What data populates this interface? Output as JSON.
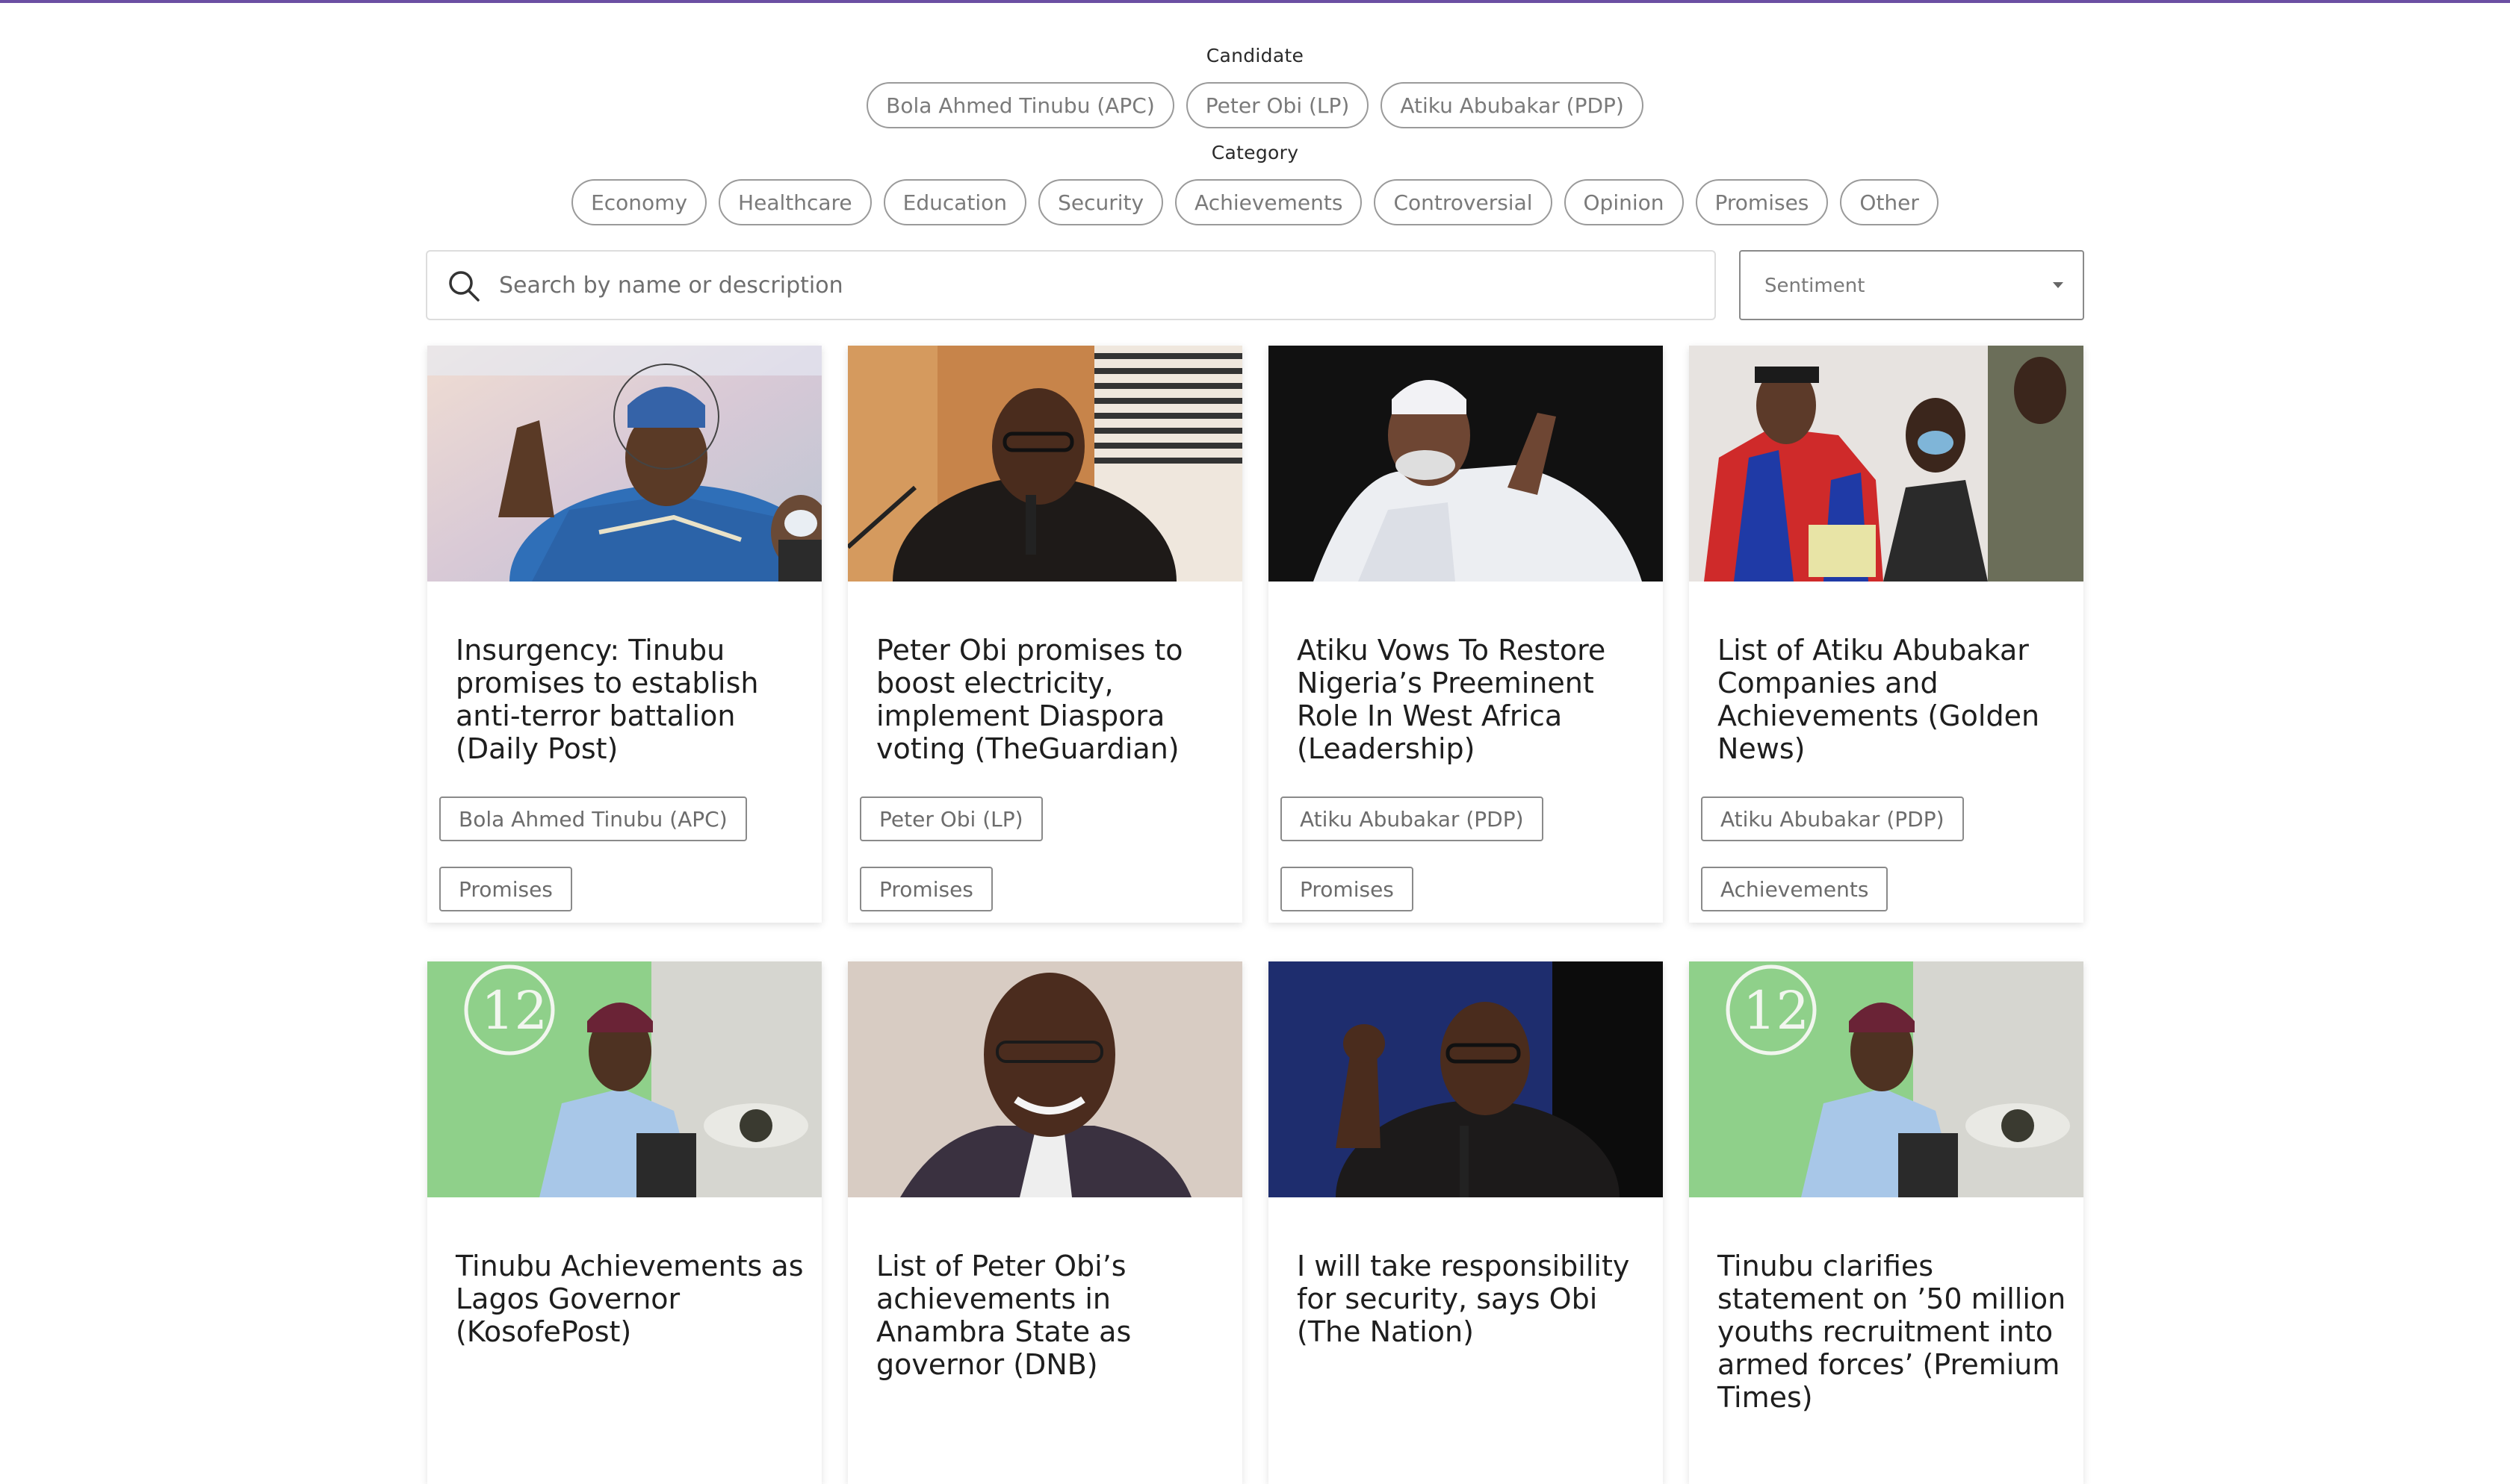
{
  "filters": {
    "candidate_label": "Candidate",
    "candidates": [
      "Bola Ahmed Tinubu (APC)",
      "Peter Obi (LP)",
      "Atiku Abubakar (PDP)"
    ],
    "category_label": "Category",
    "categories": [
      "Economy",
      "Healthcare",
      "Education",
      "Security",
      "Achievements",
      "Controversial",
      "Opinion",
      "Promises",
      "Other"
    ]
  },
  "search": {
    "placeholder": "Search by name or description",
    "value": "",
    "icon": "search-icon"
  },
  "sentiment": {
    "label": "Sentiment",
    "icon": "chevron-down-icon"
  },
  "cards": [
    {
      "title": "Insurgency: Tinubu promises to establish anti-terror battalion (Daily Post)",
      "candidate": "Bola Ahmed Tinubu (APC)",
      "category": "Promises",
      "image": "Tinubu speaking at podium in blue agbada"
    },
    {
      "title": "Peter Obi promises to boost electricity, implement Diaspora voting (TheGuardian)",
      "candidate": "Peter Obi (LP)",
      "category": "Promises",
      "image": "Peter Obi speaking into microphone"
    },
    {
      "title": "Atiku Vows To Restore Nigeria’s Preeminent Role In West Africa (Leadership)",
      "candidate": "Atiku Abubakar (PDP)",
      "category": "Promises",
      "image": "Atiku in white attire gesturing"
    },
    {
      "title": "List of Atiku Abubakar Companies and Achievements (Golden News)",
      "candidate": "Atiku Abubakar (PDP)",
      "category": "Achievements",
      "image": "Atiku in academic robe with attendees"
    },
    {
      "title": "Tinubu Achievements as Lagos Governor (KosofePost)",
      "candidate": "",
      "category": "",
      "image": "Tinubu at colloquium podium with green banner"
    },
    {
      "title": "List of Peter Obi’s achievements in Anambra State as governor (DNB)",
      "candidate": "",
      "category": "",
      "image": "Peter Obi smiling portrait"
    },
    {
      "title": "I will take responsibility for security, says Obi (The Nation)",
      "candidate": "",
      "category": "",
      "image": "Peter Obi speaking with raised fist"
    },
    {
      "title": "Tinubu clarifies statement on ’50 million youths recruitment into armed forces’ (Premium Times)",
      "candidate": "",
      "category": "",
      "image": "Tinubu at colloquium podium with green banner"
    }
  ],
  "colors": {
    "accent_line": "#6b4fa3",
    "chip_border": "#9a9a9a",
    "chip_text": "#7a7a7a"
  }
}
